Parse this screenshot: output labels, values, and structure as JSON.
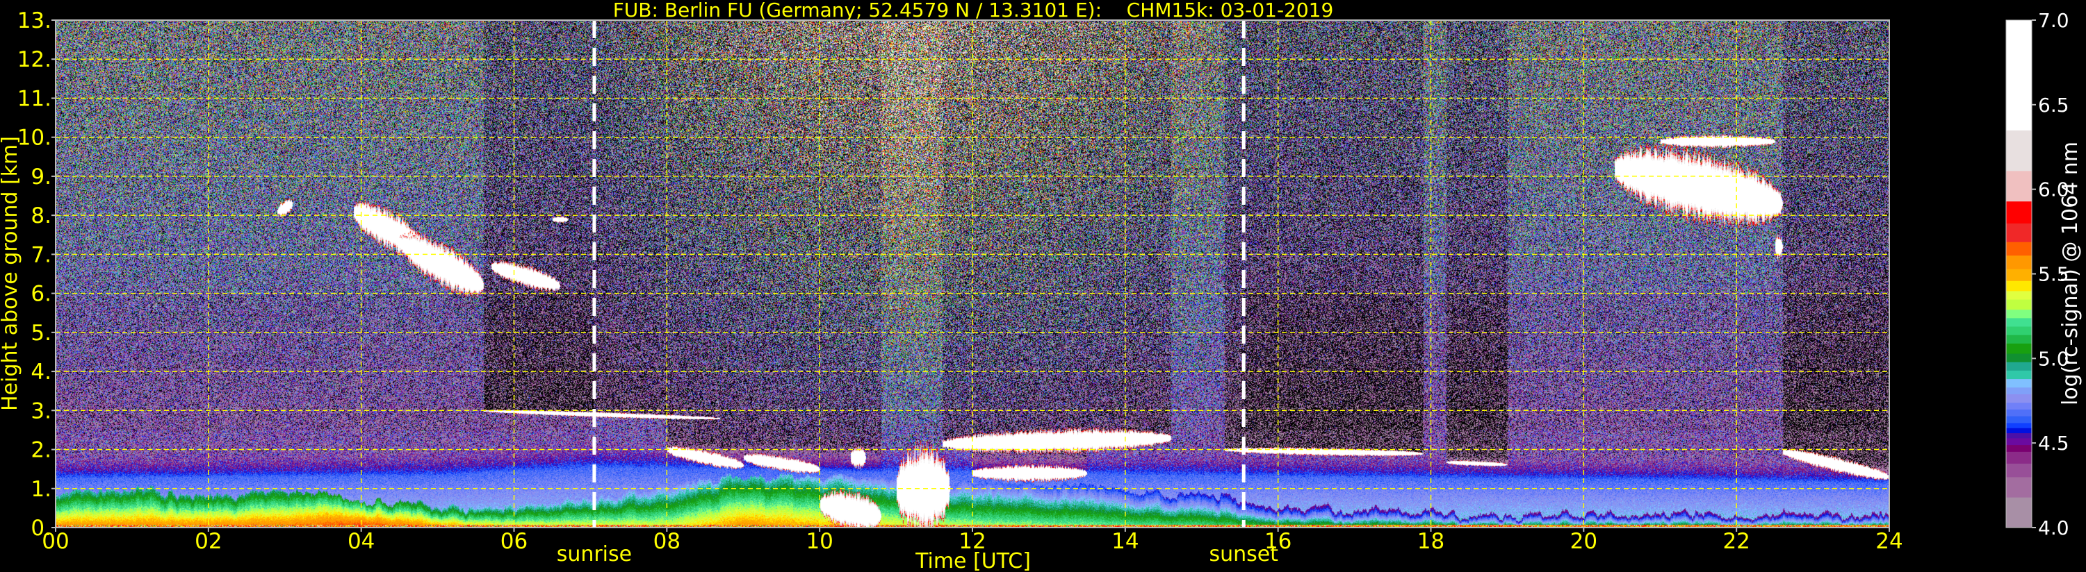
{
  "chart_data": {
    "type": "heatmap",
    "title": "FUB: Berlin FU (Germany; 52.4579 N / 13.3101 E):    CHM15k: 03-01-2019",
    "xlabel": "Time [UTC]",
    "ylabel": "Height above ground [km]",
    "xlim": [
      0,
      24
    ],
    "ylim": [
      0,
      13
    ],
    "grid": true,
    "grid_color": "#ffff00",
    "text_color": "#ffff00",
    "xticks": [
      {
        "value": 0,
        "label": "00"
      },
      {
        "value": 2,
        "label": "02"
      },
      {
        "value": 4,
        "label": "04"
      },
      {
        "value": 6,
        "label": "06"
      },
      {
        "value": 8,
        "label": "08"
      },
      {
        "value": 10,
        "label": "10"
      },
      {
        "value": 12,
        "label": "12"
      },
      {
        "value": 14,
        "label": "14"
      },
      {
        "value": 16,
        "label": "16"
      },
      {
        "value": 18,
        "label": "18"
      },
      {
        "value": 20,
        "label": "20"
      },
      {
        "value": 22,
        "label": "22"
      },
      {
        "value": 24,
        "label": "24"
      }
    ],
    "yticks": [
      {
        "value": 0,
        "label": "0."
      },
      {
        "value": 1,
        "label": "1."
      },
      {
        "value": 2,
        "label": "2."
      },
      {
        "value": 3,
        "label": "3."
      },
      {
        "value": 4,
        "label": "4."
      },
      {
        "value": 5,
        "label": "5."
      },
      {
        "value": 6,
        "label": "6."
      },
      {
        "value": 7,
        "label": "7."
      },
      {
        "value": 8,
        "label": "8."
      },
      {
        "value": 9,
        "label": "9."
      },
      {
        "value": 10,
        "label": "10."
      },
      {
        "value": 11,
        "label": "11."
      },
      {
        "value": 12,
        "label": "12."
      },
      {
        "value": 13,
        "label": "13."
      }
    ],
    "annotations": [
      {
        "label": "sunrise",
        "time": 7.05,
        "line_color": "#ffffff"
      },
      {
        "label": "sunset",
        "time": 15.55,
        "line_color": "#ffffff"
      }
    ],
    "colorbar": {
      "label": "log(rc-signal) @ 1064 nm",
      "range": [
        4.0,
        7.0
      ],
      "ticks": [
        {
          "value": 4.0,
          "label": "4.0"
        },
        {
          "value": 4.5,
          "label": "4.5"
        },
        {
          "value": 5.0,
          "label": "5.0"
        },
        {
          "value": 5.5,
          "label": "5.5"
        },
        {
          "value": 6.0,
          "label": "6.0"
        },
        {
          "value": 6.5,
          "label": "6.5"
        },
        {
          "value": 7.0,
          "label": "7.0"
        }
      ],
      "below_range_color": "#000000",
      "levels": [
        {
          "from": 4.0,
          "to": 4.18,
          "color": "#a88fa6"
        },
        {
          "from": 4.18,
          "to": 4.3,
          "color": "#a36da0"
        },
        {
          "from": 4.3,
          "to": 4.38,
          "color": "#984f98"
        },
        {
          "from": 4.38,
          "to": 4.45,
          "color": "#8b2b88"
        },
        {
          "from": 4.45,
          "to": 4.49,
          "color": "#7a0070"
        },
        {
          "from": 4.49,
          "to": 4.53,
          "color": "#6a0aa0"
        },
        {
          "from": 4.53,
          "to": 4.56,
          "color": "#4a10a8"
        },
        {
          "from": 4.56,
          "to": 4.59,
          "color": "#0010e0"
        },
        {
          "from": 4.59,
          "to": 4.62,
          "color": "#1040ff"
        },
        {
          "from": 4.62,
          "to": 4.66,
          "color": "#3060f8"
        },
        {
          "from": 4.66,
          "to": 4.7,
          "color": "#5070f8"
        },
        {
          "from": 4.7,
          "to": 4.74,
          "color": "#7080f8"
        },
        {
          "from": 4.74,
          "to": 4.79,
          "color": "#8c90f0"
        },
        {
          "from": 4.79,
          "to": 4.83,
          "color": "#80a0f8"
        },
        {
          "from": 4.83,
          "to": 4.88,
          "color": "#80c0ff"
        },
        {
          "from": 4.88,
          "to": 4.93,
          "color": "#30c8a8"
        },
        {
          "from": 4.93,
          "to": 4.98,
          "color": "#20a890"
        },
        {
          "from": 4.98,
          "to": 5.03,
          "color": "#109030"
        },
        {
          "from": 5.03,
          "to": 5.09,
          "color": "#18a010"
        },
        {
          "from": 5.09,
          "to": 5.14,
          "color": "#20b848"
        },
        {
          "from": 5.14,
          "to": 5.19,
          "color": "#30d070"
        },
        {
          "from": 5.19,
          "to": 5.24,
          "color": "#40e090"
        },
        {
          "from": 5.24,
          "to": 5.29,
          "color": "#80ff80"
        },
        {
          "from": 5.29,
          "to": 5.35,
          "color": "#c0ff40"
        },
        {
          "from": 5.35,
          "to": 5.4,
          "color": "#e0ff40"
        },
        {
          "from": 5.4,
          "to": 5.46,
          "color": "#ffe800"
        },
        {
          "from": 5.46,
          "to": 5.53,
          "color": "#ffb000"
        },
        {
          "from": 5.53,
          "to": 5.61,
          "color": "#ff9800"
        },
        {
          "from": 5.61,
          "to": 5.69,
          "color": "#ff6000"
        },
        {
          "from": 5.69,
          "to": 5.8,
          "color": "#f02828"
        },
        {
          "from": 5.8,
          "to": 5.93,
          "color": "#ff0000"
        },
        {
          "from": 5.93,
          "to": 6.11,
          "color": "#f0c0c0"
        },
        {
          "from": 6.11,
          "to": 6.35,
          "color": "#e8e0e0"
        },
        {
          "from": 6.35,
          "to": 7.0,
          "color": "#ffffff"
        }
      ]
    }
  }
}
